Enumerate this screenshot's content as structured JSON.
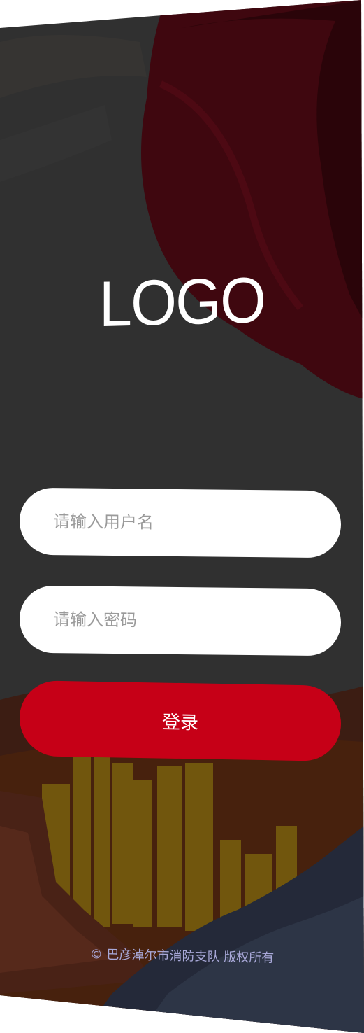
{
  "logo": {
    "text": "LOGO"
  },
  "login_form": {
    "username_placeholder": "请输入用户名",
    "password_placeholder": "请输入密码",
    "login_label": "登录"
  },
  "footer": {
    "copyright": "© 巴彦淖尔市消防支队 版权所有"
  },
  "colors": {
    "overlay": "#3b3b3b",
    "accent_red": "#c60017",
    "flag_red": "#5a0a16",
    "field_bg": "#ffffff",
    "placeholder": "#9a9a9a",
    "footer_text": "#a8a8d8",
    "buildings": "#8a6a10"
  }
}
